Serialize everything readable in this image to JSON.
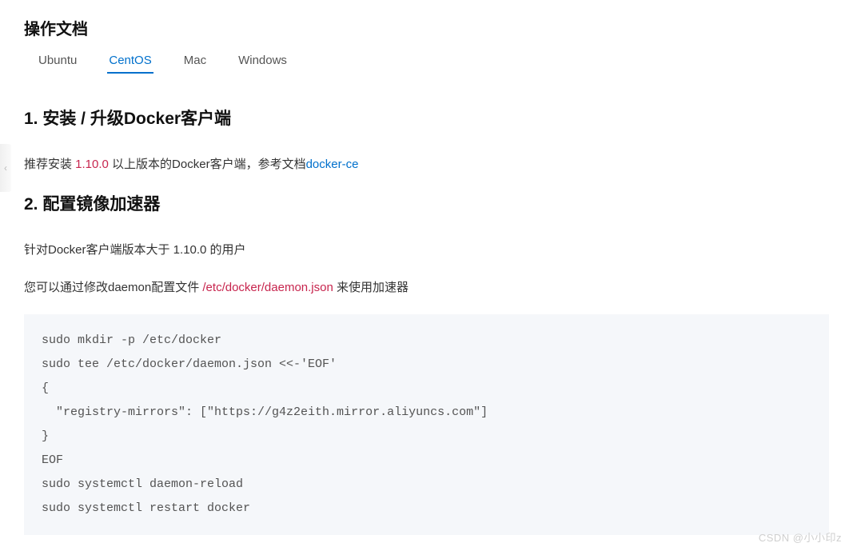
{
  "title": "操作文档",
  "tabs": {
    "items": [
      {
        "label": "Ubuntu",
        "active": false
      },
      {
        "label": "CentOS",
        "active": true
      },
      {
        "label": "Mac",
        "active": false
      },
      {
        "label": "Windows",
        "active": false
      }
    ]
  },
  "section1": {
    "heading": "1. 安装 / 升级Docker客户端",
    "para_prefix": "推荐安装 ",
    "version": "1.10.0",
    "para_mid": " 以上版本的Docker客户端，参考文档",
    "link_text": "docker-ce"
  },
  "section2": {
    "heading": "2. 配置镜像加速器",
    "para1": "针对Docker客户端版本大于 1.10.0 的用户",
    "para2_prefix": "您可以通过修改daemon配置文件 ",
    "path": "/etc/docker/daemon.json",
    "para2_suffix": " 来使用加速器",
    "code": "sudo mkdir -p /etc/docker\nsudo tee /etc/docker/daemon.json <<-'EOF'\n{\n  \"registry-mirrors\": [\"https://g4z2eith.mirror.aliyuncs.com\"]\n}\nEOF\nsudo systemctl daemon-reload\nsudo systemctl restart docker"
  },
  "collapse_icon": "‹",
  "watermark": "CSDN @小小印z"
}
